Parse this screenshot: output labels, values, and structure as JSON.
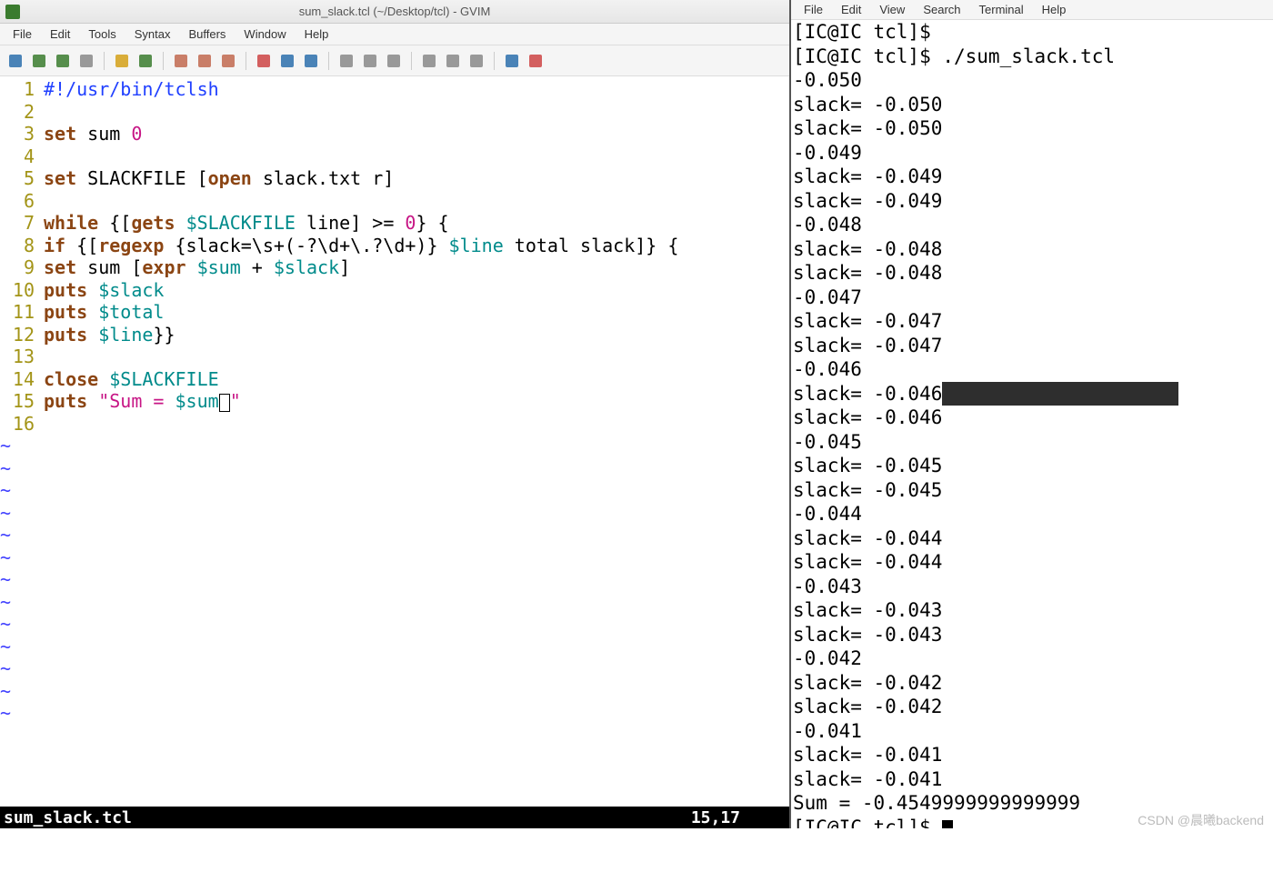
{
  "gvim": {
    "title": "sum_slack.tcl (~/Desktop/tcl) - GVIM",
    "menu": [
      "File",
      "Edit",
      "Tools",
      "Syntax",
      "Buffers",
      "Window",
      "Help"
    ],
    "status_file": "sum_slack.tcl",
    "status_pos": "15,17",
    "tildes": 13,
    "code_lines": [
      {
        "n": "1",
        "tokens": [
          {
            "t": "#!/usr/bin/tclsh",
            "c": "kw-blue"
          }
        ]
      },
      {
        "n": "2",
        "tokens": []
      },
      {
        "n": "3",
        "tokens": [
          {
            "t": "set",
            "c": "kw-brown"
          },
          {
            "t": " sum ",
            "c": "kw-black"
          },
          {
            "t": "0",
            "c": "kw-magenta"
          }
        ]
      },
      {
        "n": "4",
        "tokens": []
      },
      {
        "n": "5",
        "tokens": [
          {
            "t": "set",
            "c": "kw-brown"
          },
          {
            "t": " SLACKFILE [",
            "c": "kw-black"
          },
          {
            "t": "open",
            "c": "kw-brown"
          },
          {
            "t": " slack.txt r]",
            "c": "kw-black"
          }
        ]
      },
      {
        "n": "6",
        "tokens": []
      },
      {
        "n": "7",
        "tokens": [
          {
            "t": "while",
            "c": "kw-brown"
          },
          {
            "t": " {[",
            "c": "kw-black"
          },
          {
            "t": "gets",
            "c": "kw-brown"
          },
          {
            "t": " ",
            "c": "kw-black"
          },
          {
            "t": "$SLACKFILE",
            "c": "kw-teal"
          },
          {
            "t": " line] >= ",
            "c": "kw-black"
          },
          {
            "t": "0",
            "c": "kw-magenta"
          },
          {
            "t": "} {",
            "c": "kw-black"
          }
        ]
      },
      {
        "n": "8",
        "tokens": [
          {
            "t": "if",
            "c": "kw-brown"
          },
          {
            "t": " {[",
            "c": "kw-black"
          },
          {
            "t": "regexp",
            "c": "kw-brown"
          },
          {
            "t": " {slack=\\s+(-?\\d+\\.?\\d+)} ",
            "c": "kw-black"
          },
          {
            "t": "$line",
            "c": "kw-teal"
          },
          {
            "t": " total slack]} {",
            "c": "kw-black"
          }
        ]
      },
      {
        "n": "9",
        "tokens": [
          {
            "t": "set",
            "c": "kw-brown"
          },
          {
            "t": " sum [",
            "c": "kw-black"
          },
          {
            "t": "expr",
            "c": "kw-brown"
          },
          {
            "t": " ",
            "c": "kw-black"
          },
          {
            "t": "$sum",
            "c": "kw-teal"
          },
          {
            "t": " + ",
            "c": "kw-black"
          },
          {
            "t": "$slack",
            "c": "kw-teal"
          },
          {
            "t": "]",
            "c": "kw-black"
          }
        ]
      },
      {
        "n": "10",
        "tokens": [
          {
            "t": "puts",
            "c": "kw-brown"
          },
          {
            "t": " ",
            "c": "kw-black"
          },
          {
            "t": "$slack",
            "c": "kw-teal"
          }
        ]
      },
      {
        "n": "11",
        "tokens": [
          {
            "t": "puts",
            "c": "kw-brown"
          },
          {
            "t": " ",
            "c": "kw-black"
          },
          {
            "t": "$total",
            "c": "kw-teal"
          }
        ]
      },
      {
        "n": "12",
        "tokens": [
          {
            "t": "puts",
            "c": "kw-brown"
          },
          {
            "t": " ",
            "c": "kw-black"
          },
          {
            "t": "$line",
            "c": "kw-teal"
          },
          {
            "t": "}}",
            "c": "kw-black"
          }
        ]
      },
      {
        "n": "13",
        "tokens": []
      },
      {
        "n": "14",
        "tokens": [
          {
            "t": "close",
            "c": "kw-brown"
          },
          {
            "t": " ",
            "c": "kw-black"
          },
          {
            "t": "$SLACKFILE",
            "c": "kw-teal"
          }
        ]
      },
      {
        "n": "15",
        "tokens": [
          {
            "t": "puts",
            "c": "kw-brown"
          },
          {
            "t": " ",
            "c": "kw-black"
          },
          {
            "t": "\"Sum = ",
            "c": "kw-magenta"
          },
          {
            "t": "$sum",
            "c": "kw-teal"
          }
        ],
        "cursor": true,
        "after_cursor": {
          "t": "\"",
          "c": "kw-magenta"
        }
      },
      {
        "n": "16",
        "tokens": []
      }
    ]
  },
  "terminal": {
    "menu": [
      "File",
      "Edit",
      "View",
      "Search",
      "Terminal",
      "Help"
    ],
    "lines": [
      {
        "t": "[IC@IC tcl]$",
        "hl": false
      },
      {
        "t": "[IC@IC tcl]$ ./sum_slack.tcl",
        "hl": false
      },
      {
        "t": "-0.050",
        "hl": false
      },
      {
        "t": "slack= -0.050",
        "hl": false
      },
      {
        "t": "slack= -0.050",
        "hl": false
      },
      {
        "t": "-0.049",
        "hl": false
      },
      {
        "t": "slack= -0.049",
        "hl": false
      },
      {
        "t": "slack= -0.049",
        "hl": false
      },
      {
        "t": "-0.048",
        "hl": false
      },
      {
        "t": "slack= -0.048",
        "hl": false
      },
      {
        "t": "slack= -0.048",
        "hl": false
      },
      {
        "t": "-0.047",
        "hl": false
      },
      {
        "t": "slack= -0.047",
        "hl": false
      },
      {
        "t": "slack= -0.047",
        "hl": false
      },
      {
        "t": "-0.046",
        "hl": false
      },
      {
        "t": "slack= -0.046",
        "hl": true
      },
      {
        "t": "slack= -0.046",
        "hl": false
      },
      {
        "t": "-0.045",
        "hl": false
      },
      {
        "t": "slack= -0.045",
        "hl": false
      },
      {
        "t": "slack= -0.045",
        "hl": false
      },
      {
        "t": "-0.044",
        "hl": false
      },
      {
        "t": "slack= -0.044",
        "hl": false
      },
      {
        "t": "slack= -0.044",
        "hl": false
      },
      {
        "t": "-0.043",
        "hl": false
      },
      {
        "t": "slack= -0.043",
        "hl": false
      },
      {
        "t": "slack= -0.043",
        "hl": false
      },
      {
        "t": "-0.042",
        "hl": false
      },
      {
        "t": "slack= -0.042",
        "hl": false
      },
      {
        "t": "slack= -0.042",
        "hl": false
      },
      {
        "t": "-0.041",
        "hl": false
      },
      {
        "t": "slack= -0.041",
        "hl": false
      },
      {
        "t": "slack= -0.041",
        "hl": false
      },
      {
        "t": "Sum = -0.4549999999999999",
        "hl": false
      }
    ],
    "prompt": "[IC@IC tcl]$ "
  },
  "watermark": "CSDN @晨曦backend",
  "toolbar_icons": [
    {
      "n": "open-icon",
      "c": "#2b6fab"
    },
    {
      "n": "save-icon",
      "c": "#3a7b2e"
    },
    {
      "n": "save-all-icon",
      "c": "#3a7b2e"
    },
    {
      "n": "print-icon",
      "c": "#888"
    },
    {
      "sep": true
    },
    {
      "n": "undo-icon",
      "c": "#d4a017"
    },
    {
      "n": "redo-icon",
      "c": "#3a7b2e"
    },
    {
      "sep": true
    },
    {
      "n": "cut-icon",
      "c": "#c1694f"
    },
    {
      "n": "copy-icon",
      "c": "#c1694f"
    },
    {
      "n": "paste-icon",
      "c": "#c1694f"
    },
    {
      "sep": true
    },
    {
      "n": "find-icon",
      "c": "#c44"
    },
    {
      "n": "next-icon",
      "c": "#2b6fab"
    },
    {
      "n": "prev-icon",
      "c": "#2b6fab"
    },
    {
      "sep": true
    },
    {
      "n": "load-session-icon",
      "c": "#888"
    },
    {
      "n": "save-session-icon",
      "c": "#888"
    },
    {
      "n": "run-script-icon",
      "c": "#888"
    },
    {
      "sep": true
    },
    {
      "n": "make-icon",
      "c": "#888"
    },
    {
      "n": "shell-icon",
      "c": "#888"
    },
    {
      "n": "tags-icon",
      "c": "#888"
    },
    {
      "sep": true
    },
    {
      "n": "help-icon",
      "c": "#2b6fab"
    },
    {
      "n": "find-help-icon",
      "c": "#c44"
    }
  ]
}
